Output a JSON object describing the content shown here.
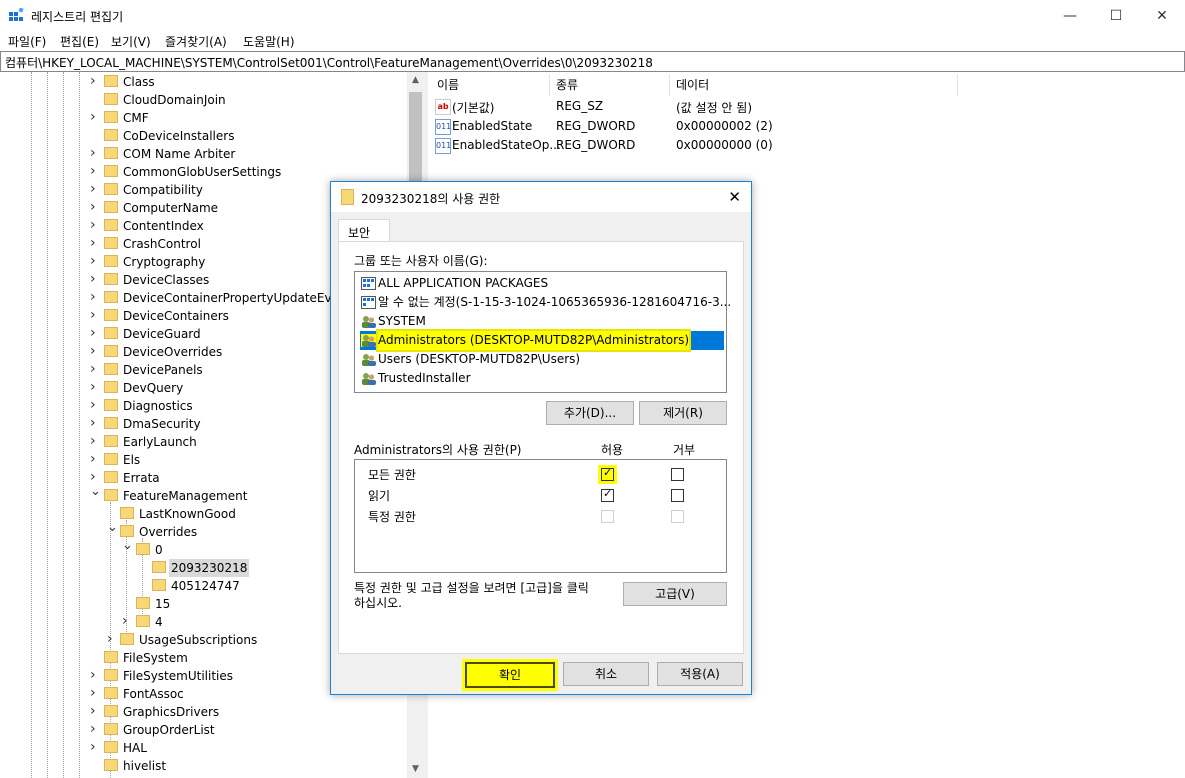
{
  "window": {
    "title": "레지스트리 편집기",
    "minimize": "—",
    "maximize": "☐",
    "close": "✕"
  },
  "menu": [
    "파일(F)",
    "편집(E)",
    "보기(V)",
    "즐겨찾기(A)",
    "도움말(H)"
  ],
  "address": "컴퓨터\\HKEY_LOCAL_MACHINE\\SYSTEM\\ControlSet001\\Control\\FeatureManagement\\Overrides\\0\\2093230218",
  "tree": [
    {
      "label": "Class",
      "expandable": true
    },
    {
      "label": "CloudDomainJoin",
      "expandable": false
    },
    {
      "label": "CMF",
      "expandable": true
    },
    {
      "label": "CoDeviceInstallers",
      "expandable": false
    },
    {
      "label": "COM Name Arbiter",
      "expandable": true
    },
    {
      "label": "CommonGlobUserSettings",
      "expandable": true
    },
    {
      "label": "Compatibility",
      "expandable": true
    },
    {
      "label": "ComputerName",
      "expandable": true
    },
    {
      "label": "ContentIndex",
      "expandable": true
    },
    {
      "label": "CrashControl",
      "expandable": true
    },
    {
      "label": "Cryptography",
      "expandable": true
    },
    {
      "label": "DeviceClasses",
      "expandable": true
    },
    {
      "label": "DeviceContainerPropertyUpdateEvents",
      "expandable": true
    },
    {
      "label": "DeviceContainers",
      "expandable": true
    },
    {
      "label": "DeviceGuard",
      "expandable": true
    },
    {
      "label": "DeviceOverrides",
      "expandable": true
    },
    {
      "label": "DevicePanels",
      "expandable": true
    },
    {
      "label": "DevQuery",
      "expandable": true
    },
    {
      "label": "Diagnostics",
      "expandable": true
    },
    {
      "label": "DmaSecurity",
      "expandable": true
    },
    {
      "label": "EarlyLaunch",
      "expandable": true
    },
    {
      "label": "Els",
      "expandable": true
    },
    {
      "label": "Errata",
      "expandable": true
    },
    {
      "label": "FeatureManagement",
      "expandable": true,
      "expanded": true
    },
    {
      "label": "LastKnownGood",
      "expandable": false,
      "level": 1
    },
    {
      "label": "Overrides",
      "expandable": true,
      "expanded": true,
      "level": 1
    },
    {
      "label": "0",
      "expandable": true,
      "expanded": true,
      "level": 2
    },
    {
      "label": "2093230218",
      "expandable": false,
      "level": 3,
      "selected": true
    },
    {
      "label": "405124747",
      "expandable": false,
      "level": 3
    },
    {
      "label": "15",
      "expandable": false,
      "level": 2
    },
    {
      "label": "4",
      "expandable": true,
      "level": 2
    },
    {
      "label": "UsageSubscriptions",
      "expandable": true,
      "level": 1
    },
    {
      "label": "FileSystem",
      "expandable": false
    },
    {
      "label": "FileSystemUtilities",
      "expandable": true
    },
    {
      "label": "FontAssoc",
      "expandable": true
    },
    {
      "label": "GraphicsDrivers",
      "expandable": true
    },
    {
      "label": "GroupOrderList",
      "expandable": true
    },
    {
      "label": "HAL",
      "expandable": true
    },
    {
      "label": "hivelist",
      "expandable": false
    }
  ],
  "columns": {
    "name": "이름",
    "type": "종류",
    "data": "데이터"
  },
  "values": [
    {
      "icon": "string-value-icon",
      "name": "(기본값)",
      "type": "REG_SZ",
      "data": "(값 설정 안 됨)"
    },
    {
      "icon": "dword-value-icon",
      "name": "EnabledState",
      "type": "REG_DWORD",
      "data": "0x00000002 (2)"
    },
    {
      "icon": "dword-value-icon",
      "name": "EnabledStateOp...",
      "type": "REG_DWORD",
      "data": "0x00000000 (0)"
    }
  ],
  "dialog": {
    "title": "2093230218의 사용 권한",
    "tab": "보안",
    "group_label": "그룹 또는 사용자 이름(G):",
    "principals": [
      {
        "name": "ALL APPLICATION PACKAGES",
        "icon": "package-group-icon"
      },
      {
        "name": "알 수 없는 계정(S-1-15-3-1024-1065365936-1281604716-3...",
        "icon": "unknown-account-icon"
      },
      {
        "name": "SYSTEM",
        "icon": "users-icon"
      },
      {
        "name": "Administrators (DESKTOP-MUTD82P\\Administrators)",
        "icon": "users-icon",
        "selected": true
      },
      {
        "name": "Users (DESKTOP-MUTD82P\\Users)",
        "icon": "users-icon"
      },
      {
        "name": "TrustedInstaller",
        "icon": "users-icon"
      }
    ],
    "add_button": "추가(D)...",
    "remove_button": "제거(R)",
    "perm_label": "Administrators의 사용 권한(P)",
    "allow_header": "허용",
    "deny_header": "거부",
    "permissions": [
      {
        "name": "모든 권한",
        "allow": true,
        "deny": false,
        "enabled": true
      },
      {
        "name": "읽기",
        "allow": true,
        "deny": false,
        "enabled": true
      },
      {
        "name": "특정 권한",
        "allow": false,
        "deny": false,
        "enabled": false
      }
    ],
    "advanced_note": "특정 권한 및 고급 설정을 보려면 [고급]을 클릭\n하십시오.",
    "advanced_button": "고급(V)",
    "ok_button": "확인",
    "cancel_button": "취소",
    "apply_button": "적용(A)",
    "check_mark": "✓"
  }
}
